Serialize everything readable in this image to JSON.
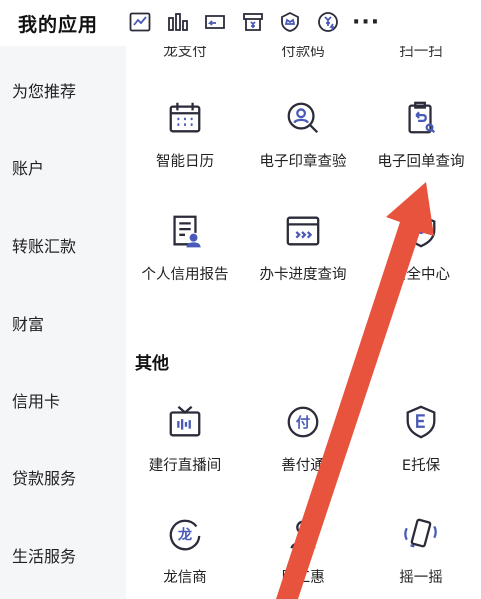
{
  "header": {
    "title": "我的应用",
    "more_label": "···"
  },
  "sidebar": {
    "items": [
      {
        "label": "为您推荐"
      },
      {
        "label": "账户"
      },
      {
        "label": "转账汇款"
      },
      {
        "label": "财富"
      },
      {
        "label": "信用卡"
      },
      {
        "label": "贷款服务"
      },
      {
        "label": "生活服务"
      }
    ]
  },
  "main": {
    "partial_row": [
      "龙支付",
      "付款码",
      "扫一扫"
    ],
    "row1": [
      "智能日历",
      "电子印章查验",
      "电子回单查询"
    ],
    "row2": [
      "个人信用报告",
      "办卡进度查询",
      "安全中心"
    ],
    "section_other": "其他",
    "row3": [
      "建行直播间",
      "善付通",
      "E托保"
    ],
    "row4": [
      "龙信商",
      "民工惠",
      "摇一摇"
    ]
  },
  "colors": {
    "icon_dark": "#2b2b3a",
    "icon_accent": "#4a5ab8",
    "arrow": "#e8533d",
    "sidebar_bg": "#f5f6f8"
  }
}
